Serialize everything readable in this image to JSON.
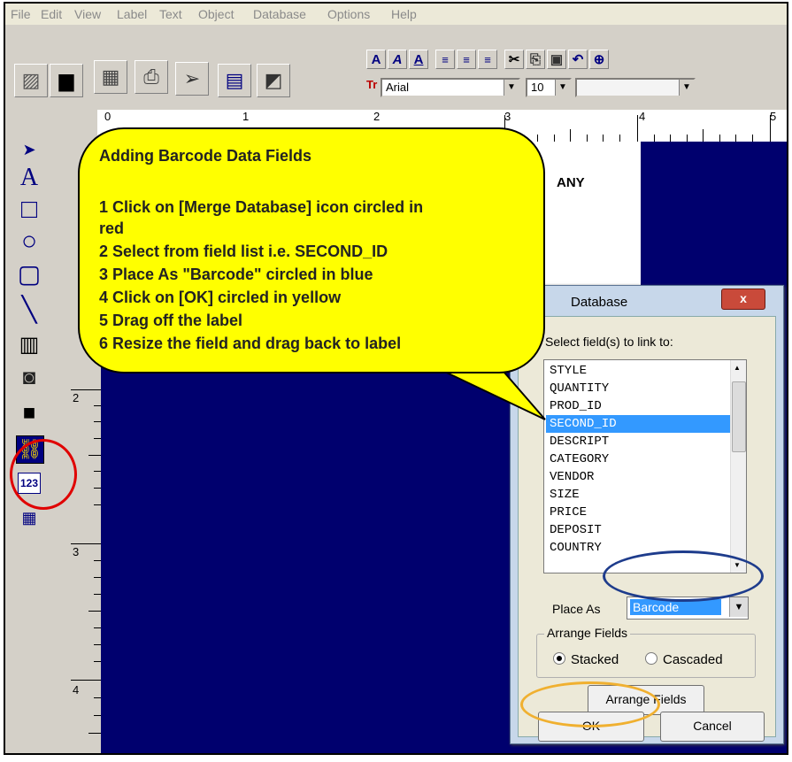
{
  "menu": [
    "File",
    "Edit",
    "View",
    "Label",
    "Text",
    "Object",
    "Database",
    "Options",
    "Help"
  ],
  "toolbar": {
    "font_name": "Arial",
    "font_size": "10",
    "text_style_buttons": [
      "A",
      "A",
      "A"
    ]
  },
  "ruler": {
    "h_numbers": [
      "0",
      "1",
      "2",
      "3",
      "4",
      "5"
    ],
    "v_numbers": [
      "2",
      "3",
      "4"
    ]
  },
  "label_text": "ANY",
  "callout": {
    "title": "Adding Barcode Data Fields",
    "lines": [
      "1 Click on [Merge Database] icon circled in",
      "  red",
      "2 Select from field list   i.e. SECOND_ID",
      "3 Place As \"Barcode\" circled in blue",
      "4 Click on [OK] circled in yellow",
      "5 Drag off the label",
      "6 Resize the field and drag back to label"
    ]
  },
  "dialog": {
    "title": "Database",
    "close": "x",
    "select_hint": "Select field(s) to link to:",
    "fields": [
      "STYLE",
      "QUANTITY",
      "PROD_ID",
      "SECOND_ID",
      "DESCRIPT",
      "CATEGORY",
      "VENDOR",
      "SIZE",
      "PRICE",
      "DEPOSIT",
      "COUNTRY"
    ],
    "selected_field": "SECOND_ID",
    "place_as_label": "Place As",
    "place_as_value": "Barcode",
    "arrange_legend": "Arrange Fields",
    "radio_stacked": "Stacked",
    "radio_cascaded": "Cascaded",
    "arrange_button": "Arrange Fields",
    "ok": "OK",
    "cancel": "Cancel"
  },
  "highlight_colors": {
    "merge_database": "#e00000",
    "place_as": "#1e3c8c",
    "ok": "#f0b030"
  }
}
